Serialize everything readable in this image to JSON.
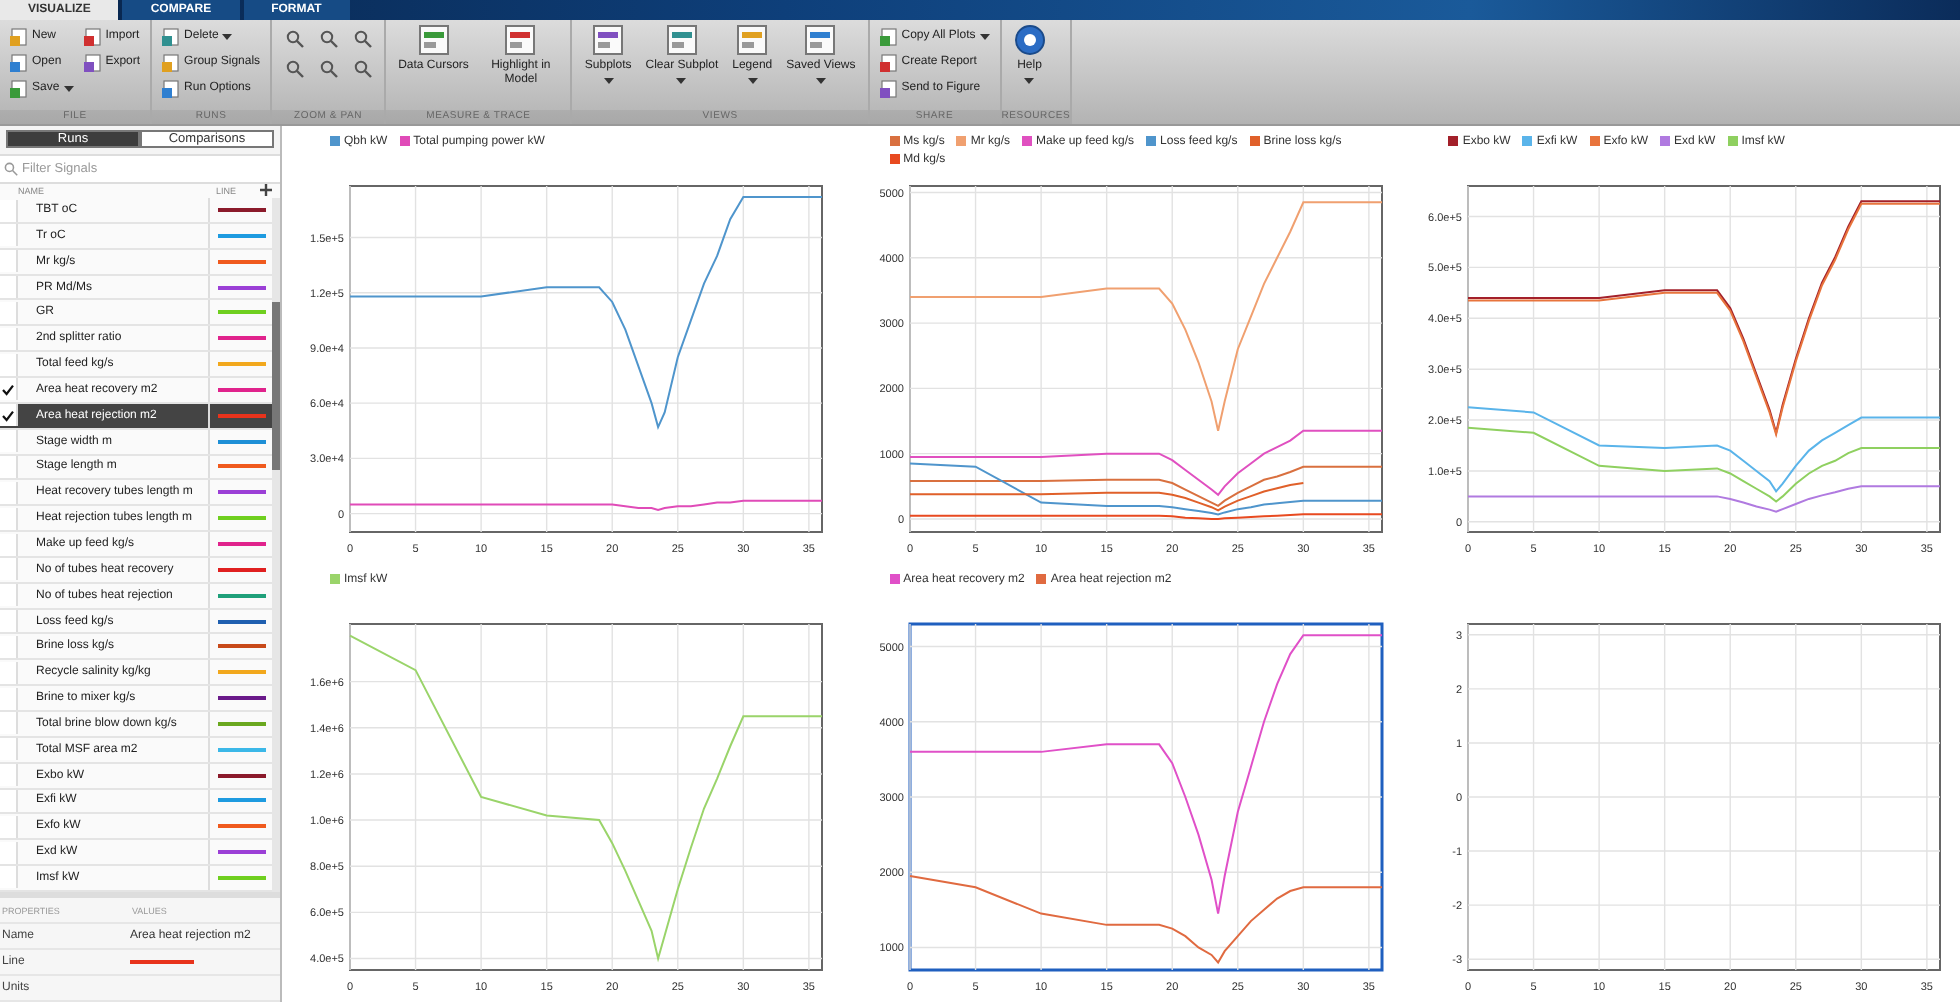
{
  "tabs": [
    {
      "label": "VISUALIZE",
      "selected": true
    },
    {
      "label": "COMPARE",
      "selected": false
    },
    {
      "label": "FORMAT",
      "selected": false
    }
  ],
  "toolstrip": {
    "groups": [
      {
        "label": "FILE",
        "columns": [
          [
            {
              "kind": "small",
              "label": "New",
              "dropdown": false
            },
            {
              "kind": "small",
              "label": "Open",
              "dropdown": false
            },
            {
              "kind": "small",
              "label": "Save",
              "dropdown": true
            }
          ],
          [
            {
              "kind": "small",
              "label": "Import",
              "dropdown": false
            },
            {
              "kind": "small",
              "label": "Export",
              "dropdown": false
            }
          ]
        ]
      },
      {
        "label": "RUNS",
        "columns": [
          [
            {
              "kind": "small",
              "label": "Delete",
              "dropdown": true
            },
            {
              "kind": "small",
              "label": "Group Signals",
              "dropdown": false
            },
            {
              "kind": "small",
              "label": "Run Options",
              "dropdown": false
            }
          ]
        ]
      },
      {
        "label": "ZOOM & PAN",
        "columns": [
          [
            {
              "kind": "icon"
            },
            {
              "kind": "icon"
            }
          ],
          [
            {
              "kind": "icon"
            },
            {
              "kind": "icon"
            }
          ],
          [
            {
              "kind": "icon"
            },
            {
              "kind": "icon"
            }
          ]
        ]
      },
      {
        "label": "MEASURE & TRACE",
        "columns": [
          [
            {
              "kind": "large",
              "label": "Data Cursors",
              "dropdown": false
            }
          ],
          [
            {
              "kind": "large",
              "label": "Highlight in Model",
              "dropdown": false
            }
          ]
        ]
      },
      {
        "label": "VIEWS",
        "columns": [
          [
            {
              "kind": "large",
              "label": "Subplots",
              "dropdown": true
            }
          ],
          [
            {
              "kind": "large",
              "label": "Clear Subplot",
              "dropdown": true
            }
          ],
          [
            {
              "kind": "large",
              "label": "Legend",
              "dropdown": true
            }
          ],
          [
            {
              "kind": "large",
              "label": "Saved Views",
              "dropdown": true
            }
          ]
        ]
      },
      {
        "label": "SHARE",
        "columns": [
          [
            {
              "kind": "small",
              "label": "Copy All Plots",
              "dropdown": true
            },
            {
              "kind": "small",
              "label": "Create Report",
              "dropdown": false
            },
            {
              "kind": "small",
              "label": "Send to Figure",
              "dropdown": false
            }
          ]
        ]
      },
      {
        "label": "RESOURCES",
        "columns": [
          [
            {
              "kind": "help",
              "label": "Help",
              "dropdown": true
            }
          ]
        ]
      }
    ]
  },
  "sidebar": {
    "tabs": [
      {
        "label": "Runs",
        "selected": true
      },
      {
        "label": "Comparisons",
        "selected": false
      }
    ],
    "filter": {
      "placeholder": "Filter Signals"
    },
    "columns": [
      "NAME",
      "LINE"
    ],
    "signals": [
      {
        "name": "TBT oC",
        "checked": false,
        "selected": false,
        "color": "#8b1a2b"
      },
      {
        "name": "Tr oC",
        "checked": false,
        "selected": false,
        "color": "#1e9be0"
      },
      {
        "name": "Mr kg/s",
        "checked": false,
        "selected": false,
        "color": "#f05a1e"
      },
      {
        "name": "PR Md/Ms",
        "checked": false,
        "selected": false,
        "color": "#9b3fd6"
      },
      {
        "name": "GR",
        "checked": false,
        "selected": false,
        "color": "#6fcf1f"
      },
      {
        "name": "2nd splitter ratio",
        "checked": false,
        "selected": false,
        "color": "#e0238c"
      },
      {
        "name": "Total feed kg/s",
        "checked": false,
        "selected": false,
        "color": "#f2a81d"
      },
      {
        "name": "Area heat recovery m2",
        "checked": true,
        "selected": false,
        "color": "#e0238c"
      },
      {
        "name": "Area heat rejection m2",
        "checked": true,
        "selected": true,
        "color": "#e8331c"
      },
      {
        "name": "Stage width m",
        "checked": false,
        "selected": false,
        "color": "#1e8fd6"
      },
      {
        "name": "Stage length m",
        "checked": false,
        "selected": false,
        "color": "#f05a1e"
      },
      {
        "name": "Heat recovery tubes length m",
        "checked": false,
        "selected": false,
        "color": "#9b3fd6"
      },
      {
        "name": "Heat rejection tubes length m",
        "checked": false,
        "selected": false,
        "color": "#6fcf1f"
      },
      {
        "name": "Make up feed kg/s",
        "checked": false,
        "selected": false,
        "color": "#e0238c"
      },
      {
        "name": "No of tubes heat recovery",
        "checked": false,
        "selected": false,
        "color": "#e02020"
      },
      {
        "name": "No of tubes heat rejection",
        "checked": false,
        "selected": false,
        "color": "#1fa07a"
      },
      {
        "name": "Loss feed kg/s",
        "checked": false,
        "selected": false,
        "color": "#1f5fb0"
      },
      {
        "name": "Brine loss kg/s",
        "checked": false,
        "selected": false,
        "color": "#c84a1a"
      },
      {
        "name": "Recycle salinity kg/kg",
        "checked": false,
        "selected": false,
        "color": "#f2a81d"
      },
      {
        "name": "Brine to mixer kg/s",
        "checked": false,
        "selected": false,
        "color": "#6a1a8a"
      },
      {
        "name": "Total brine blow down kg/s",
        "checked": false,
        "selected": false,
        "color": "#6aa81f"
      },
      {
        "name": "Total MSF area m2",
        "checked": false,
        "selected": false,
        "color": "#3cb8e8"
      },
      {
        "name": "Exbo kW",
        "checked": false,
        "selected": false,
        "color": "#8b1a2b"
      },
      {
        "name": "Exfi kW",
        "checked": false,
        "selected": false,
        "color": "#1e9be0"
      },
      {
        "name": "Exfo kW",
        "checked": false,
        "selected": false,
        "color": "#f05a1e"
      },
      {
        "name": "Exd kW",
        "checked": false,
        "selected": false,
        "color": "#9b3fd6"
      },
      {
        "name": "Imsf kW",
        "checked": false,
        "selected": false,
        "color": "#6fcf1f"
      }
    ],
    "properties": {
      "columns": [
        "PROPERTIES",
        "VALUES"
      ],
      "rows": [
        {
          "kind": "text",
          "property": "Name",
          "value": "Area heat rejection m2"
        },
        {
          "kind": "line",
          "property": "Line",
          "color": "#e8331c"
        },
        {
          "kind": "text",
          "property": "Units"
        }
      ]
    }
  },
  "plots": [
    {
      "selected": false,
      "chart_data": {
        "type": "line",
        "grid": true,
        "x": [
          0,
          5,
          10,
          15,
          19,
          20,
          21,
          22,
          23,
          23.5,
          24,
          25,
          26,
          27,
          28,
          29,
          30,
          36
        ],
        "xlim": [
          0,
          36
        ],
        "ylim": [
          -10000,
          178000
        ],
        "xticks": [
          0,
          5,
          10,
          15,
          20,
          25,
          30,
          35
        ],
        "yticks": [
          0,
          {
            "value": 30000,
            "label": "3.0e+4"
          },
          {
            "value": 60000,
            "label": "6.0e+4"
          },
          {
            "value": 90000,
            "label": "9.0e+4"
          },
          {
            "value": 120000,
            "label": "1.2e+5"
          },
          {
            "value": 150000,
            "label": "1.5e+5"
          }
        ],
        "series": [
          {
            "name": "Qbh kW",
            "color": "#4f95cc",
            "values": [
              118000,
              118000,
              118000,
              123000,
              123000,
              115000,
              100000,
              80000,
              60000,
              47000,
              55000,
              85000,
              105000,
              125000,
              140000,
              160000,
              172000,
              172000
            ]
          },
          {
            "name": "Total pumping power kW",
            "color": "#e04bb8",
            "values": [
              5000,
              5000,
              5000,
              5000,
              5000,
              5000,
              4000,
              3000,
              3000,
              2000,
              3000,
              4000,
              4000,
              5000,
              6000,
              6000,
              7000,
              7000
            ]
          }
        ]
      }
    },
    {
      "selected": false,
      "chart_data": {
        "type": "line",
        "x": [
          0,
          5,
          10,
          15,
          19,
          20,
          21,
          22,
          23,
          23.5,
          24,
          25,
          26,
          27,
          28,
          29,
          30,
          36
        ],
        "xlim": [
          0,
          36
        ],
        "grid": true,
        "ylim": [
          -200,
          5100
        ],
        "xticks": [
          0,
          5,
          10,
          15,
          20,
          25,
          30,
          35
        ],
        "yticks": [
          0,
          1000,
          2000,
          3000,
          4000,
          5000
        ],
        "series": [
          {
            "name": "Ms kg/s",
            "color": "#d9703f",
            "values": [
              580,
              580,
              580,
              600,
              600,
              550,
              450,
              350,
              250,
              200,
              280,
              400,
              500,
              600,
              650,
              720,
              800,
              800
            ]
          },
          {
            "name": "Mr kg/s",
            "color": "#f0a070",
            "values": [
              3400,
              3400,
              3400,
              3530,
              3530,
              3300,
              2900,
              2400,
              1800,
              1350,
              1800,
              2600,
              3100,
              3600,
              4000,
              4400,
              4850,
              4850
            ]
          },
          {
            "name": "Make up feed kg/s",
            "color": "#e050c0",
            "values": [
              950,
              950,
              950,
              1000,
              1000,
              900,
              750,
              600,
              450,
              370,
              500,
              700,
              850,
              1000,
              1100,
              1200,
              1350,
              1350
            ]
          },
          {
            "name": "Loss feed kg/s",
            "color": "#4f95cc",
            "values": [
              850,
              800,
              250,
              200,
              200,
              180,
              150,
              120,
              90,
              70,
              100,
              150,
              180,
              220,
              240,
              260,
              280,
              280
            ]
          },
          {
            "name": "Brine loss kg/s",
            "color": "#e0602a",
            "values": [
              380,
              380,
              380,
              400,
              400,
              370,
              320,
              250,
              180,
              130,
              190,
              280,
              350,
              420,
              470,
              520,
              550,
              null
            ]
          },
          {
            "name": "Md kg/s",
            "color": "#e84a20",
            "values": [
              50,
              50,
              50,
              50,
              50,
              40,
              20,
              10,
              0,
              0,
              10,
              20,
              30,
              40,
              50,
              60,
              70,
              70
            ]
          }
        ]
      }
    },
    {
      "selected": false,
      "chart_data": {
        "type": "line",
        "x": [
          0,
          5,
          10,
          15,
          19,
          20,
          21,
          22,
          23,
          23.5,
          24,
          25,
          26,
          27,
          28,
          29,
          30,
          36
        ],
        "xlim": [
          0,
          36
        ],
        "grid": true,
        "ylim": [
          -20000,
          660000
        ],
        "xticks": [
          0,
          5,
          10,
          15,
          20,
          25,
          30,
          35
        ],
        "yticks": [
          0,
          {
            "value": 100000,
            "label": "1.0e+5"
          },
          {
            "value": 200000,
            "label": "2.0e+5"
          },
          {
            "value": 300000,
            "label": "3.0e+5"
          },
          {
            "value": 400000,
            "label": "4.0e+5"
          },
          {
            "value": 500000,
            "label": "5.0e+5"
          },
          {
            "value": 600000,
            "label": "6.0e+5"
          }
        ],
        "series": [
          {
            "name": "Exbo kW",
            "color": "#a3202a",
            "values": [
              440000,
              440000,
              440000,
              455000,
              455000,
              420000,
              360000,
              290000,
              220000,
              175000,
              230000,
              320000,
              400000,
              470000,
              520000,
              580000,
              630000,
              630000
            ]
          },
          {
            "name": "Exfi kW",
            "color": "#5ab4ea",
            "values": [
              225000,
              215000,
              150000,
              145000,
              150000,
              140000,
              120000,
              100000,
              80000,
              60000,
              75000,
              110000,
              140000,
              160000,
              175000,
              190000,
              205000,
              205000
            ]
          },
          {
            "name": "Exfo kW",
            "color": "#e8743c",
            "values": [
              435000,
              435000,
              435000,
              450000,
              450000,
              415000,
              355000,
              285000,
              215000,
              172000,
              225000,
              315000,
              395000,
              465000,
              515000,
              575000,
              625000,
              625000
            ]
          },
          {
            "name": "Exd kW",
            "color": "#b07ae0",
            "values": [
              50000,
              50000,
              50000,
              50000,
              50000,
              45000,
              38000,
              30000,
              24000,
              20000,
              25000,
              35000,
              45000,
              52000,
              58000,
              65000,
              70000,
              70000
            ]
          },
          {
            "name": "Imsf kW",
            "color": "#8fd060",
            "values": [
              185000,
              175000,
              110000,
              100000,
              105000,
              95000,
              80000,
              65000,
              50000,
              40000,
              50000,
              75000,
              95000,
              110000,
              120000,
              135000,
              145000,
              145000
            ]
          }
        ]
      }
    },
    {
      "selected": false,
      "chart_data": {
        "type": "line",
        "x": [
          0,
          5,
          10,
          15,
          19,
          20,
          21,
          22,
          23,
          23.5,
          24,
          25,
          26,
          27,
          28,
          29,
          30,
          36
        ],
        "xlim": [
          0,
          36
        ],
        "grid": true,
        "ylim": [
          350000,
          1850000
        ],
        "xticks": [
          0,
          5,
          10,
          15,
          20,
          25,
          30,
          35
        ],
        "yticks": [
          {
            "value": 400000,
            "label": "4.0e+5"
          },
          {
            "value": 600000,
            "label": "6.0e+5"
          },
          {
            "value": 800000,
            "label": "8.0e+5"
          },
          {
            "value": 1000000,
            "label": "1.0e+6"
          },
          {
            "value": 1200000,
            "label": "1.2e+6"
          },
          {
            "value": 1400000,
            "label": "1.4e+6"
          },
          {
            "value": 1600000,
            "label": "1.6e+6"
          }
        ],
        "series": [
          {
            "name": "Imsf kW",
            "color": "#9ad46a",
            "values": [
              1800000,
              1650000,
              1100000,
              1020000,
              1000000,
              900000,
              780000,
              650000,
              520000,
              400000,
              500000,
              700000,
              880000,
              1050000,
              1180000,
              1320000,
              1450000,
              1450000
            ]
          }
        ]
      }
    },
    {
      "selected": true,
      "chart_data": {
        "type": "line",
        "x": [
          0,
          5,
          10,
          15,
          19,
          20,
          21,
          22,
          23,
          23.5,
          24,
          25,
          26,
          27,
          28,
          29,
          30,
          36
        ],
        "xlim": [
          0,
          36
        ],
        "grid": true,
        "ylim": [
          700,
          5300
        ],
        "xticks": [
          0,
          5,
          10,
          15,
          20,
          25,
          30,
          35
        ],
        "yticks": [
          1000,
          2000,
          3000,
          4000,
          5000
        ],
        "series": [
          {
            "name": "Area heat recovery m2",
            "color": "#e050c8",
            "values": [
              3600,
              3600,
              3600,
              3700,
              3700,
              3450,
              3000,
              2500,
              1900,
              1450,
              1950,
              2800,
              3400,
              4000,
              4500,
              4900,
              5150,
              5150
            ]
          },
          {
            "name": "Area heat rejection m2",
            "color": "#e06a40",
            "values": [
              1950,
              1800,
              1450,
              1300,
              1300,
              1250,
              1150,
              1000,
              900,
              800,
              950,
              1150,
              1350,
              1500,
              1650,
              1750,
              1800,
              1800
            ]
          }
        ]
      }
    },
    {
      "selected": false,
      "chart_data": {
        "type": "line",
        "xlim": [
          0,
          36
        ],
        "grid": true,
        "ylim": [
          -3.2,
          3.2
        ],
        "xticks": [
          0,
          5,
          10,
          15,
          20,
          25,
          30,
          35
        ],
        "yticks": [
          -3,
          -2,
          -1,
          0,
          1,
          2,
          3
        ]
      }
    }
  ]
}
